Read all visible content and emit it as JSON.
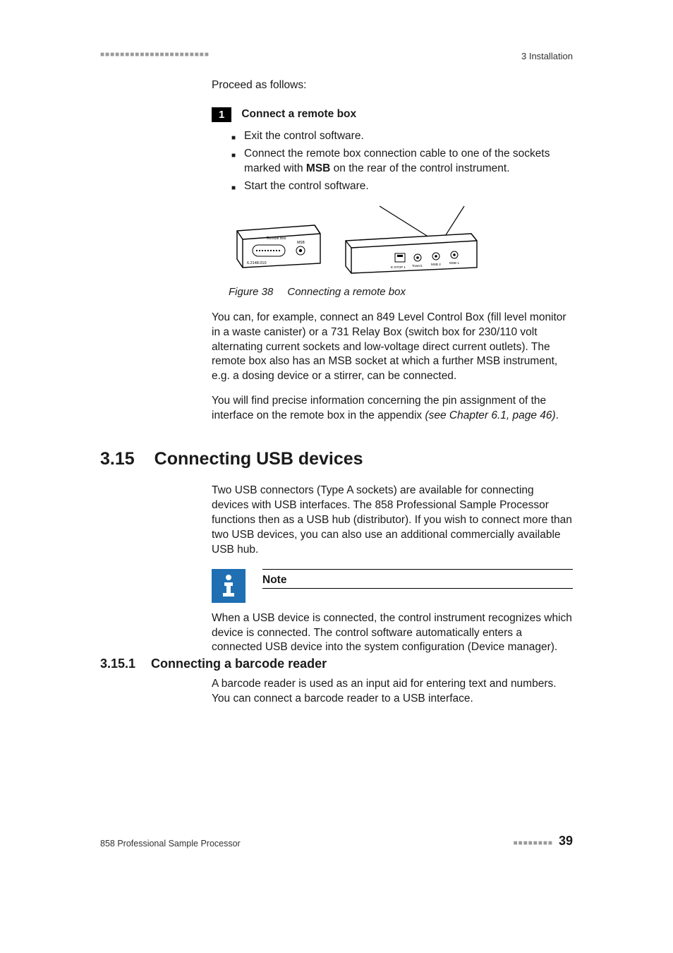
{
  "header": {
    "dashes": "■■■■■■■■■■■■■■■■■■■■■■",
    "chapter": "3 Installation"
  },
  "intro": "Proceed as follows:",
  "step": {
    "num": "1",
    "title": "Connect a remote box",
    "bullets": {
      "b1": "Exit the control software.",
      "b2a": "Connect the remote box connection cable to one of the sockets marked with ",
      "b2b": "MSB",
      "b2c": " on the rear of the control instrument.",
      "b3": "Start the control software."
    }
  },
  "figure": {
    "label": "Figure 38",
    "caption": "Connecting a remote box",
    "boxA": {
      "line1": "Remote Box",
      "line2": "MSB",
      "line3": "6.2148.010"
    },
    "boxB": {
      "p1": "E-STOP 1",
      "p2": "Tower1",
      "p3": "MSB 2",
      "p4": "MSB 1"
    }
  },
  "para1": "You can, for example, connect an 849 Level Control Box (fill level monitor in a waste canister) or a 731 Relay Box (switch box for 230/110 volt alternating current sockets and low-voltage direct current outlets). The remote box also has an MSB socket at which a further MSB instrument, e.g. a dosing device or a stirrer, can be connected.",
  "para2a": "You will find precise information concerning the pin assignment of the interface on the remote box in the appendix ",
  "para2b": "(see Chapter 6.1, page 46)",
  "para2c": ".",
  "section315": {
    "num": "3.15",
    "title": "Connecting USB devices",
    "para": "Two USB connectors (Type A sockets) are available for connecting devices with USB interfaces. The 858 Professional Sample Processor functions then as a USB hub (distributor). If you wish to connect more than two USB devices, you can also use an additional commercially available USB hub.",
    "note_title": "Note",
    "note_body": "When a USB device is connected, the control instrument recognizes which device is connected. The control software automatically enters a connected USB device into the system configuration (Device manager)."
  },
  "subsection": {
    "num": "3.15.1",
    "title": "Connecting a barcode reader",
    "para": "A barcode reader is used as an input aid for entering text and numbers. You can connect a barcode reader to a USB interface."
  },
  "footer": {
    "left": "858 Professional Sample Processor",
    "dashes": "■■■■■■■■",
    "page": "39"
  }
}
